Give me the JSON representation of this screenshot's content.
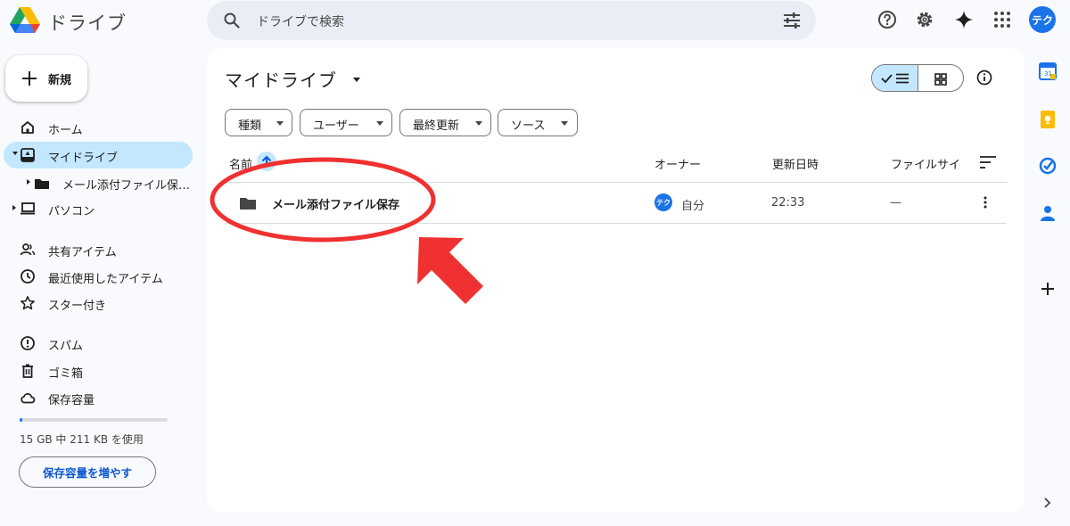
{
  "app": {
    "title": "ドライブ"
  },
  "search": {
    "placeholder": "ドライブで検索"
  },
  "account": {
    "avatar_text": "テク"
  },
  "new_button": {
    "label": "新規"
  },
  "sidebar": {
    "items": [
      {
        "label": "ホーム",
        "icon": "home-icon"
      },
      {
        "label": "マイドライブ",
        "icon": "my-drive-icon",
        "active": true
      },
      {
        "label": "メール添付ファイル保…",
        "icon": "folder-icon"
      },
      {
        "label": "パソコン",
        "icon": "computer-icon"
      },
      {
        "label": "共有アイテム",
        "icon": "shared-icon"
      },
      {
        "label": "最近使用したアイテム",
        "icon": "recent-icon"
      },
      {
        "label": "スター付き",
        "icon": "star-icon"
      },
      {
        "label": "スパム",
        "icon": "spam-icon"
      },
      {
        "label": "ゴミ箱",
        "icon": "trash-icon"
      },
      {
        "label": "保存容量",
        "icon": "cloud-icon"
      }
    ]
  },
  "storage": {
    "used_fraction": 0.01,
    "text": "15 GB 中 211 KB を使用",
    "button_label": "保存容量を増やす"
  },
  "main": {
    "title": "マイドライブ",
    "filters": [
      "種類",
      "ユーザー",
      "最終更新",
      "ソース"
    ],
    "columns": {
      "name": "名前",
      "owner": "オーナー",
      "modified": "更新日時",
      "size": "ファイルサイ"
    },
    "rows": [
      {
        "name": "メール添付ファイル保存",
        "owner_avatar": "テク",
        "owner": "自分",
        "modified": "22:33",
        "size": "—"
      }
    ]
  },
  "colors": {
    "accent": "#0b57d0",
    "active_bg": "#c2e7ff",
    "annotation": "#f03131"
  }
}
